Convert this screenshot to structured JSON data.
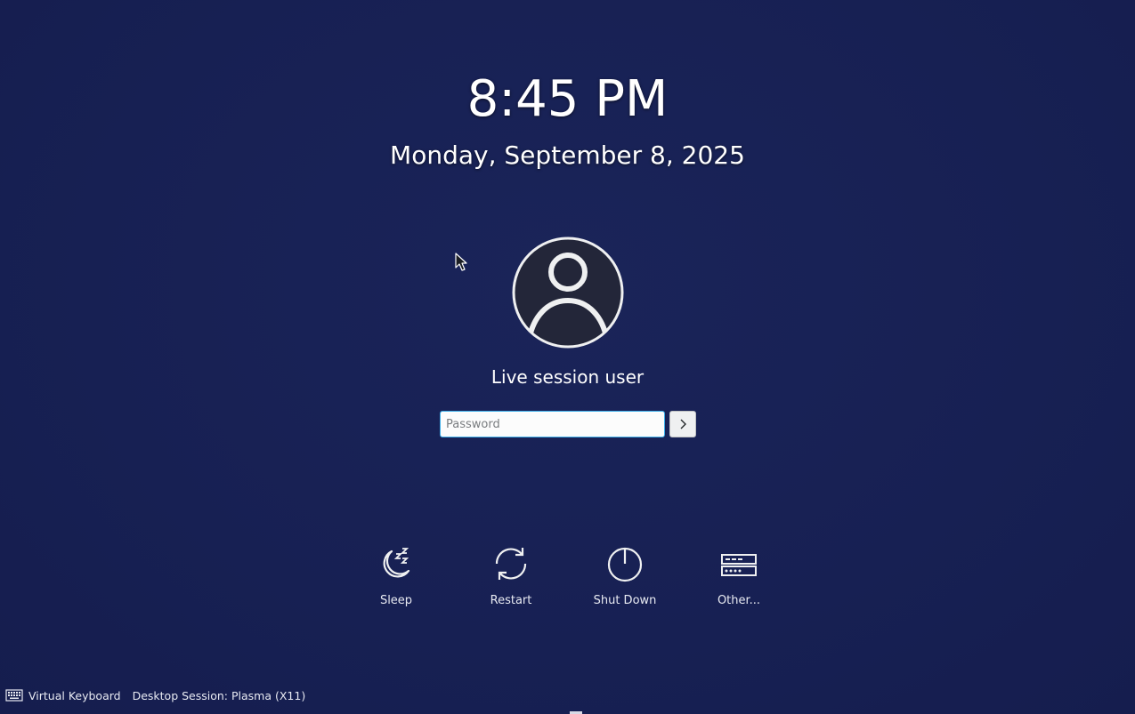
{
  "clock": {
    "time": "8:45 PM",
    "date": "Monday, September 8, 2025"
  },
  "user": {
    "name": "Live session user",
    "avatar_icon": "user-icon"
  },
  "login": {
    "password_placeholder": "Password",
    "submit_icon": "chevron-right-icon"
  },
  "actions": [
    {
      "label": "Sleep",
      "icon": "sleep-icon"
    },
    {
      "label": "Restart",
      "icon": "restart-icon"
    },
    {
      "label": "Shut Down",
      "icon": "power-icon"
    },
    {
      "label": "Other...",
      "icon": "other-sessions-icon"
    }
  ],
  "bottom_bar": {
    "virtual_keyboard": "Virtual Keyboard",
    "desktop_session": "Desktop Session: Plasma (X11)"
  },
  "colors": {
    "background": "#182055",
    "accent": "#3daee9",
    "avatar_fill": "#232639",
    "text": "#ffffff"
  }
}
